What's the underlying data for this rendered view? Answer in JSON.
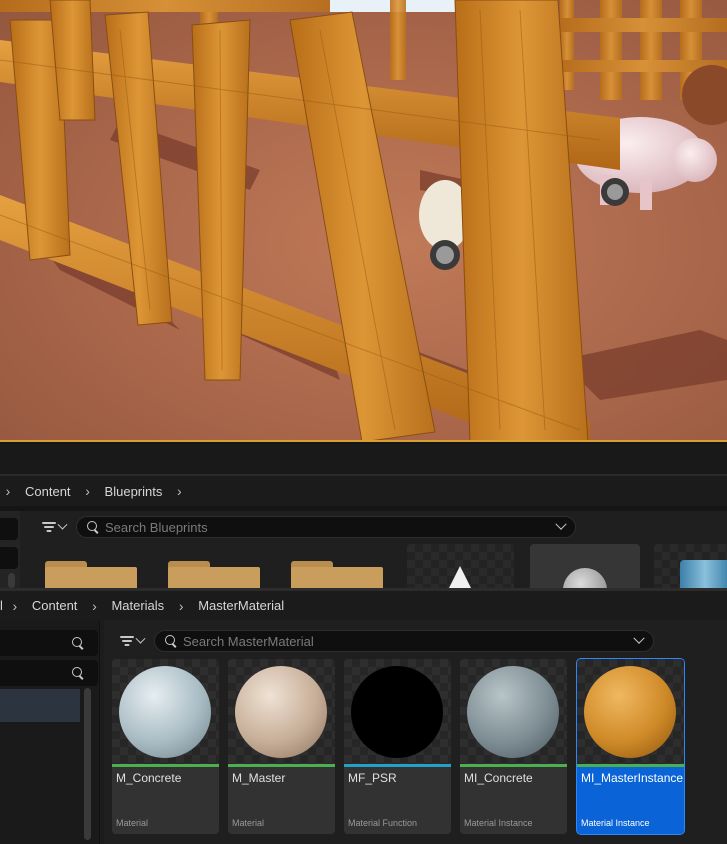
{
  "upper_browser": {
    "breadcrumbs": [
      "Content",
      "Blueprints"
    ],
    "search_placeholder": "Search Blueprints"
  },
  "lower_browser": {
    "breadcrumbs": [
      "l",
      "Content",
      "Materials",
      "MasterMaterial"
    ],
    "search_placeholder": "Search MasterMaterial",
    "assets": [
      {
        "name": "M_Concrete",
        "type": "Material",
        "strip_color": "#4caf50"
      },
      {
        "name": "M_Master",
        "type": "Material",
        "strip_color": "#4caf50"
      },
      {
        "name": "MF_PSR",
        "type": "Material Function",
        "strip_color": "#26a0c8"
      },
      {
        "name": "MI_Concrete",
        "type": "Material Instance",
        "strip_color": "#4caf50"
      },
      {
        "name": "MI_MasterInstance",
        "type": "Material Instance",
        "strip_color": "#4caf50"
      }
    ],
    "selected_asset": "MI_MasterInstance"
  },
  "colors": {
    "selection": "#0a64d8",
    "viewport_border": "#d8a030",
    "wood": "#d08a2a"
  }
}
